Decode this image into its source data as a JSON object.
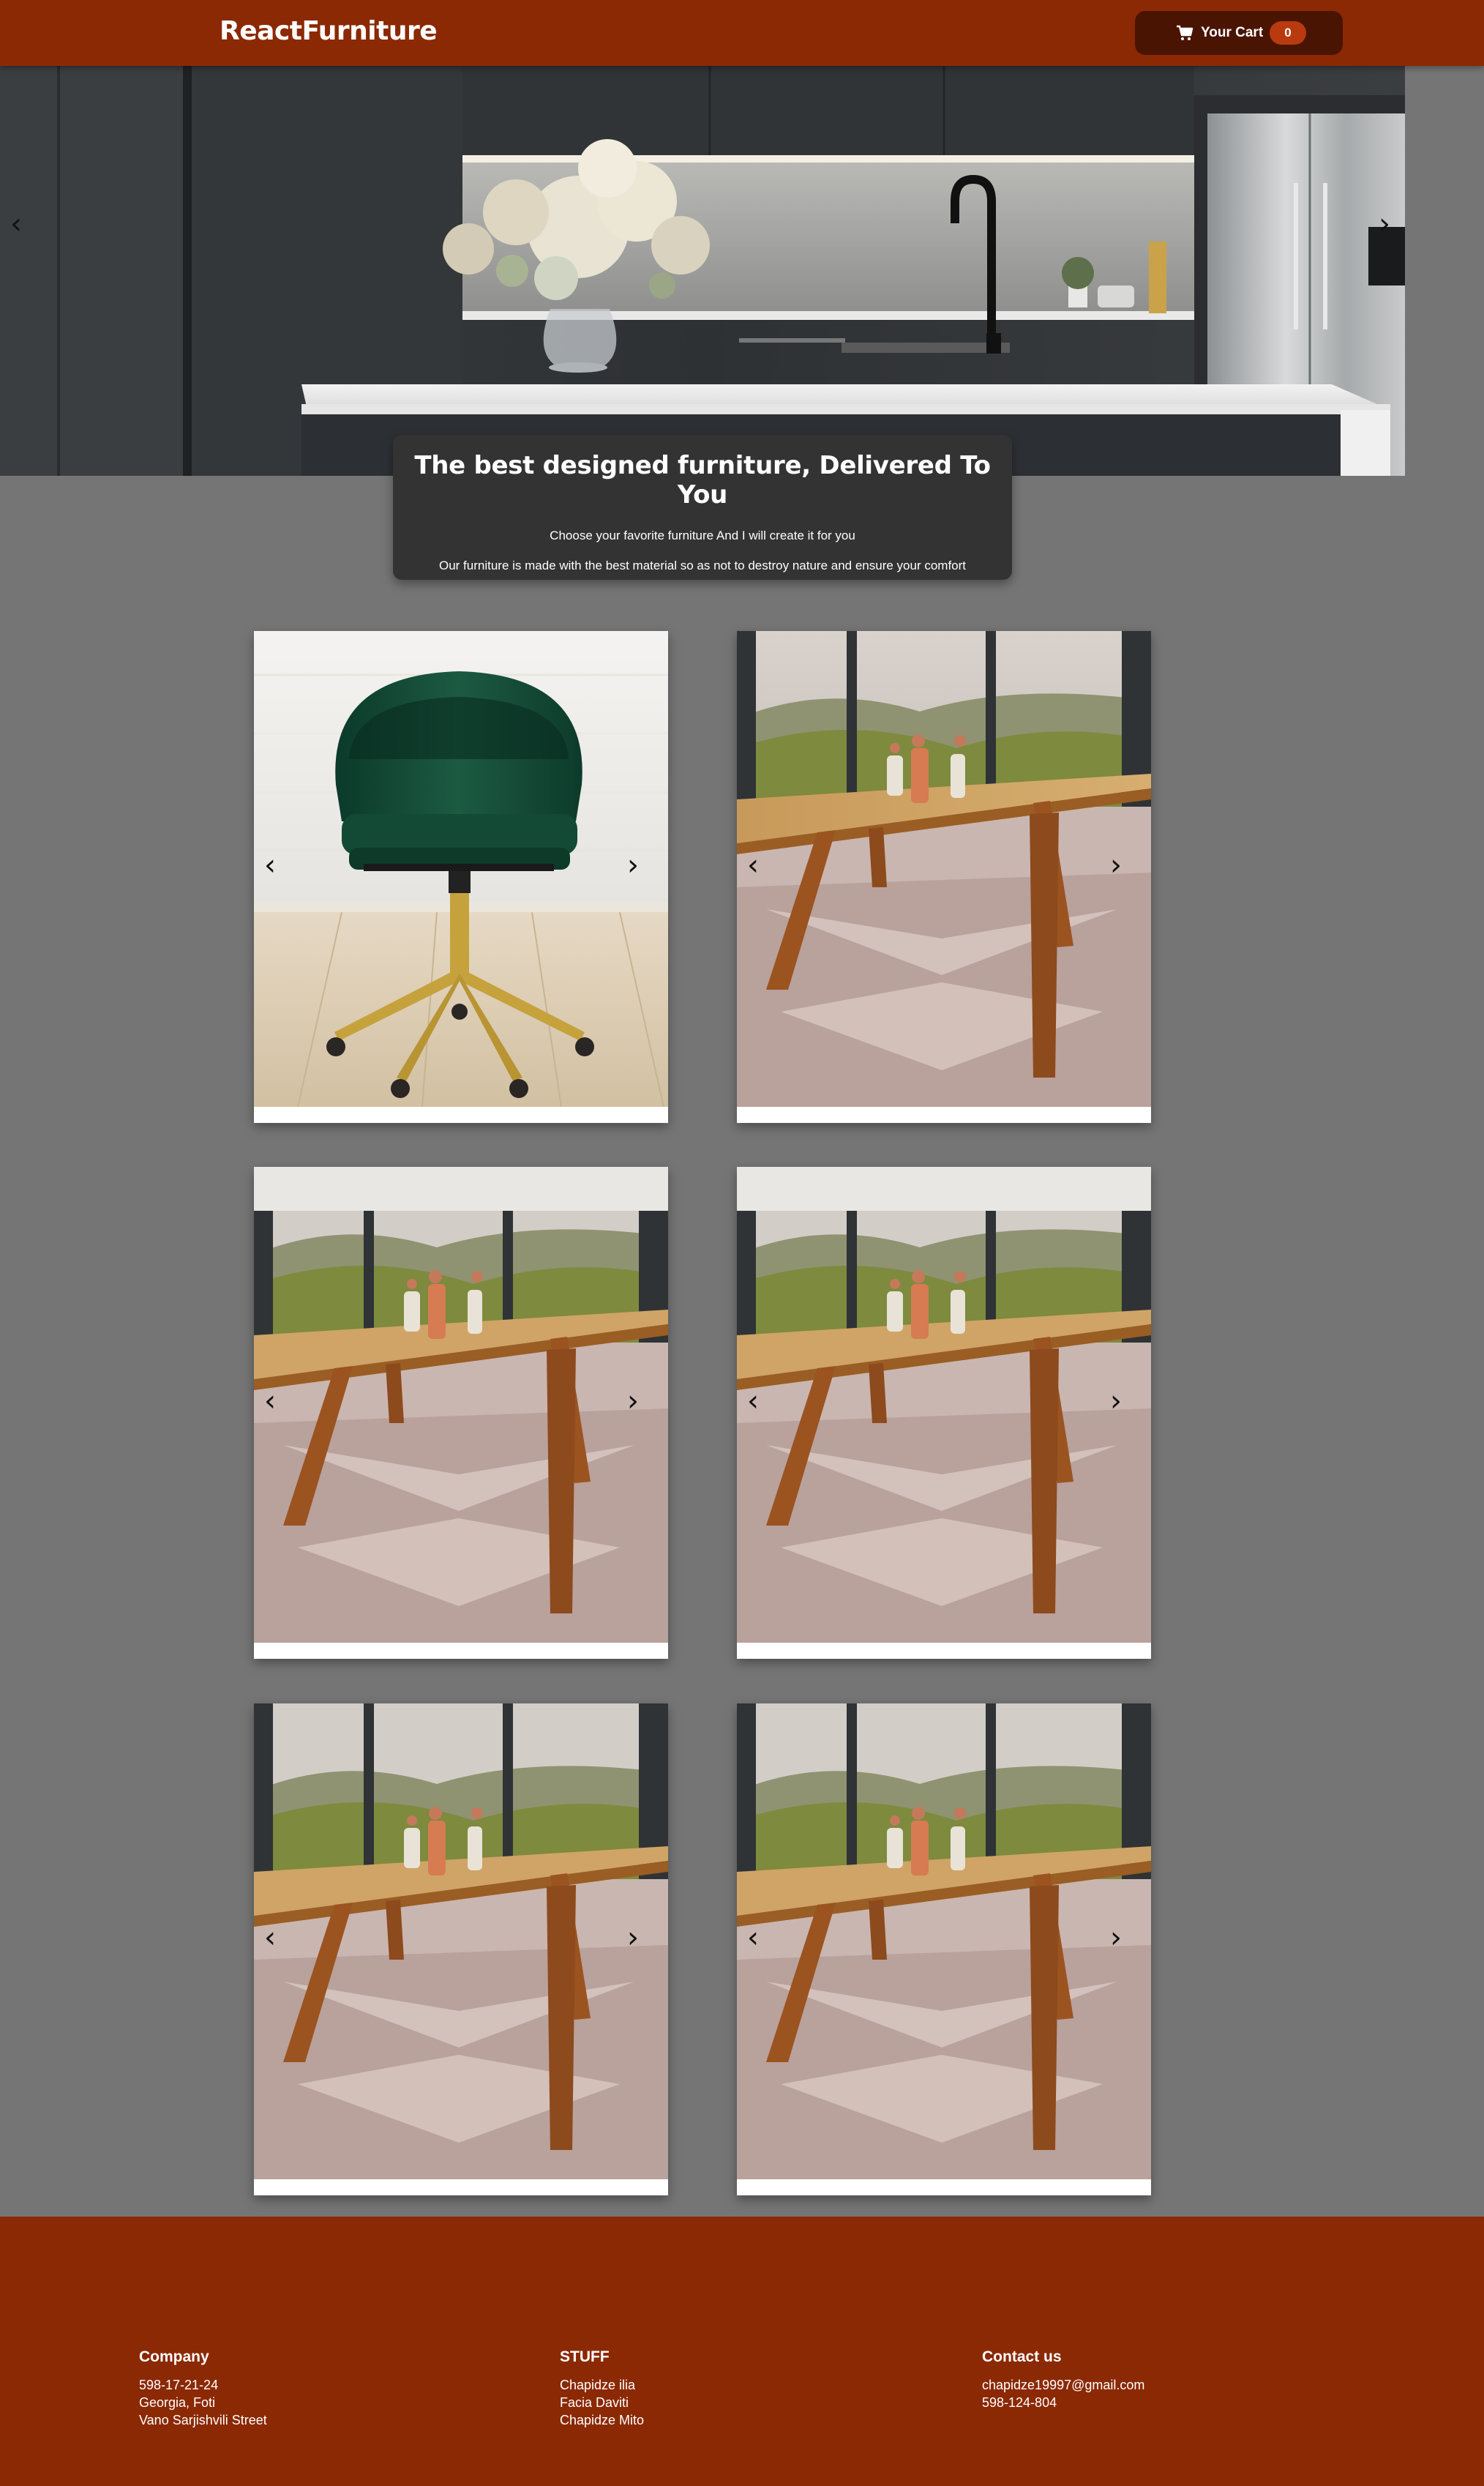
{
  "header": {
    "brand": "ReactFurniture",
    "cart_label": "Your Cart",
    "cart_count": "0"
  },
  "hero": {
    "title": "The best designed furniture, Delivered To You",
    "line1": "Choose your favorite furniture And I will create it for you",
    "line2": "Our furniture is made with the best material so as not to destroy nature and ensure your comfort",
    "prev_arrow": "‹",
    "next_arrow": "›"
  },
  "products": [
    {
      "image": "green-velvet-office-chair",
      "prev": "‹",
      "next": "›"
    },
    {
      "image": "wooden-dining-table",
      "prev": "‹",
      "next": "›"
    },
    {
      "image": "wooden-dining-table",
      "prev": "‹",
      "next": "›"
    },
    {
      "image": "wooden-dining-table",
      "prev": "‹",
      "next": "›"
    },
    {
      "image": "wooden-dining-table",
      "prev": "‹",
      "next": "›"
    },
    {
      "image": "wooden-dining-table",
      "prev": "‹",
      "next": "›"
    }
  ],
  "footer": {
    "company": {
      "heading": "Company",
      "lines": [
        "598-17-21-24",
        "Georgia, Foti",
        "Vano Sarjishvili Street"
      ]
    },
    "stuff": {
      "heading": "STUFF",
      "lines": [
        "Chapidze ilia",
        "Facia Daviti",
        "Chapidze Mito"
      ]
    },
    "contact": {
      "heading": "Contact us",
      "lines": [
        "chapidze19997@gmail.com",
        "598-124-804"
      ]
    }
  },
  "colors": {
    "header": "#8b2904",
    "cart_button": "#4a1402",
    "cart_badge": "#b93a0f",
    "page_background": "#757575",
    "hero_card": "#333333",
    "footer": "#8b2904"
  }
}
